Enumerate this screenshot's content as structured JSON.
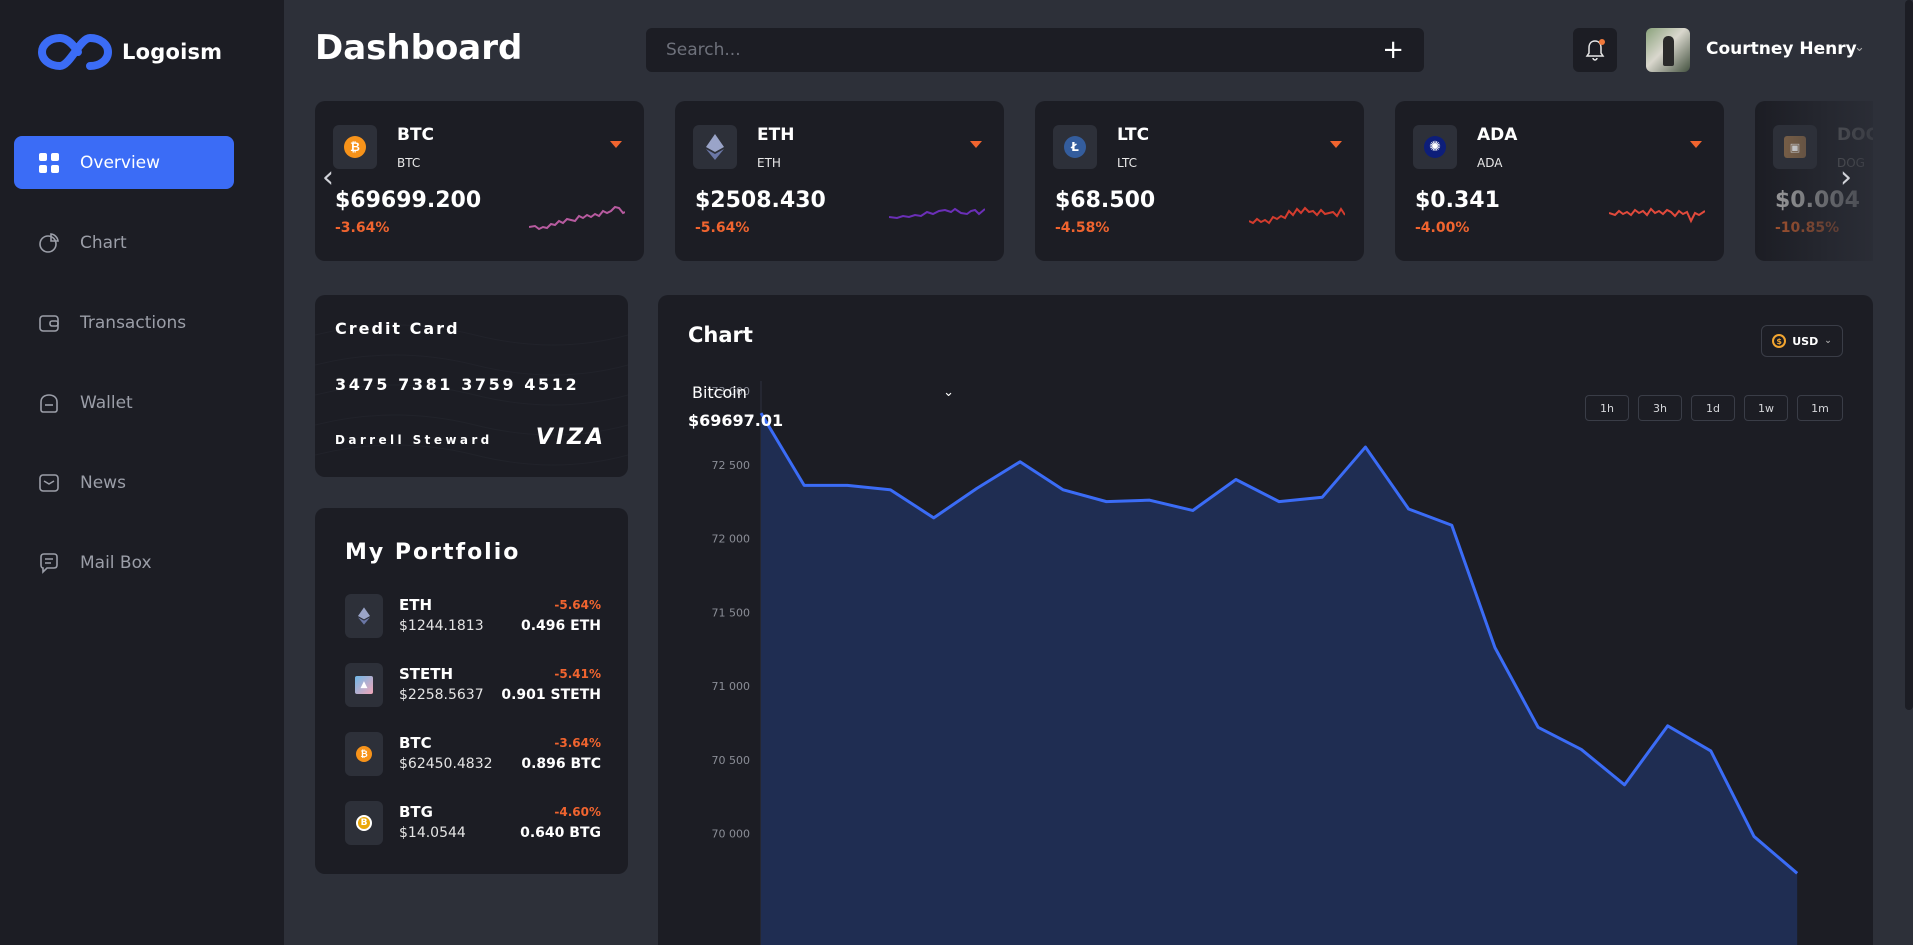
{
  "app": {
    "name": "Logoism"
  },
  "sidebar": {
    "items": [
      {
        "label": "Overview",
        "icon": "grid-icon",
        "active": true
      },
      {
        "label": "Chart",
        "icon": "pie-chart-icon"
      },
      {
        "label": "Transactions",
        "icon": "wallet-card-icon"
      },
      {
        "label": "Wallet",
        "icon": "wallet-icon"
      },
      {
        "label": "News",
        "icon": "mail-icon"
      },
      {
        "label": "Mail Box",
        "icon": "chat-icon"
      }
    ]
  },
  "header": {
    "title": "Dashboard",
    "search_placeholder": "Search...",
    "add_label": "+",
    "user_name": "Courtney Henry"
  },
  "tickers": [
    {
      "symbol": "BTC",
      "sub": "BTC",
      "price": "$69699.200",
      "change": "-3.64%",
      "spark_color": "#b85ba0",
      "coin_color": "#f7931a",
      "coin_glyph": "₿"
    },
    {
      "symbol": "ETH",
      "sub": "ETH",
      "price": "$2508.430",
      "change": "-5.64%",
      "spark_color": "#6b2fb8",
      "coin_color": "#627eea",
      "coin_glyph": "◆"
    },
    {
      "symbol": "LTC",
      "sub": "LTC",
      "price": "$68.500",
      "change": "-4.58%",
      "spark_color": "#d43c2e",
      "coin_color": "#345d9d",
      "coin_glyph": "Ł"
    },
    {
      "symbol": "ADA",
      "sub": "ADA",
      "price": "$0.341",
      "change": "-4.00%",
      "spark_color": "#e24a3c",
      "coin_color": "#0d1e7a",
      "coin_glyph": "✺"
    },
    {
      "symbol": "DOG",
      "sub": "DOG",
      "price": "$0.004",
      "change": "-10.85%",
      "spark_color": "#e24a3c",
      "coin_color": "#8a6a4a",
      "coin_glyph": "▣"
    }
  ],
  "credit_card": {
    "title": "Credit Card",
    "number": "3475 7381 3759 4512",
    "holder": "Darrell Steward",
    "brand": "VIZA"
  },
  "portfolio": {
    "title": "My Portfolio",
    "items": [
      {
        "symbol": "ETH",
        "value": "$1244.1813",
        "change": "-5.64%",
        "amount": "0.496 ETH",
        "icon_color": "#627eea",
        "glyph": "◆"
      },
      {
        "symbol": "STETH",
        "value": "$2258.5637",
        "change": "-5.41%",
        "amount": "0.901 STETH",
        "icon_color": "#6fb8e8",
        "glyph": "▲"
      },
      {
        "symbol": "BTC",
        "value": "$62450.4832",
        "change": "-3.64%",
        "amount": "0.896 BTC",
        "icon_color": "#f7931a",
        "glyph": "₿"
      },
      {
        "symbol": "BTG",
        "value": "$14.0544",
        "change": "-4.60%",
        "amount": "0.640 BTG",
        "icon_color": "#eba809",
        "glyph": "B"
      }
    ]
  },
  "chart_panel": {
    "title": "Chart",
    "currency": "USD",
    "asset": "Bitcoin",
    "asset_price": "$69697.01",
    "timeframes": [
      "1h",
      "3h",
      "1d",
      "1w",
      "1m"
    ]
  },
  "chart_data": {
    "type": "area",
    "series": [
      {
        "values": [
          72850,
          72360,
          72360,
          72330,
          72140,
          72340,
          72520,
          72330,
          72250,
          72260,
          72190,
          72400,
          72250,
          72280,
          72620,
          72200,
          72090,
          71260,
          70720,
          70570,
          70330,
          70730,
          70560,
          69980,
          69730
        ]
      }
    ],
    "yticks": [
      "73 000",
      "72 500",
      "72 000",
      "71 500",
      "71 000",
      "70 500",
      "70 000"
    ],
    "ylim": [
      69680,
      73000
    ],
    "colors": {
      "line": "#3b6cf6",
      "fill": "#1f2d52"
    },
    "grid": false
  }
}
